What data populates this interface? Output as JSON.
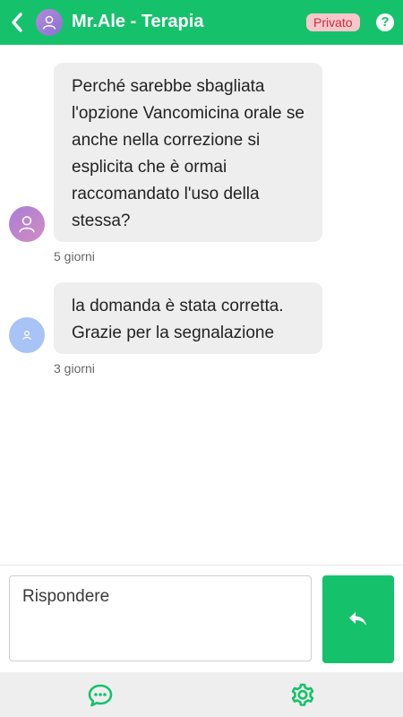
{
  "header": {
    "title": "Mr.Ale - Terapia",
    "badge": "Privato",
    "help": "?",
    "colors": {
      "background": "#15c26b",
      "badge_bg": "#f9c7cb",
      "badge_text": "#c2323f"
    },
    "icons": {
      "back": "chevron-left-icon",
      "avatar": "user-icon",
      "help": "question-circle-icon"
    }
  },
  "messages": [
    {
      "text": "Perché sarebbe sbagliata l'opzione Vancomicina orale se anche nella correzione si esplicita che è ormai raccomandato l'uso della stessa?",
      "time": "5 giorni",
      "avatar_icon": "user-icon"
    },
    {
      "text": "la domanda è stata corretta. Grazie per la segnalazione",
      "time": "3 giorni",
      "avatar_icon": "user-icon"
    }
  ],
  "composer": {
    "placeholder": "Rispondere",
    "send_icon": "reply-icon"
  },
  "bottom_nav": {
    "items": [
      {
        "icon": "chat-icon"
      },
      {
        "icon": "gear-icon"
      }
    ]
  }
}
